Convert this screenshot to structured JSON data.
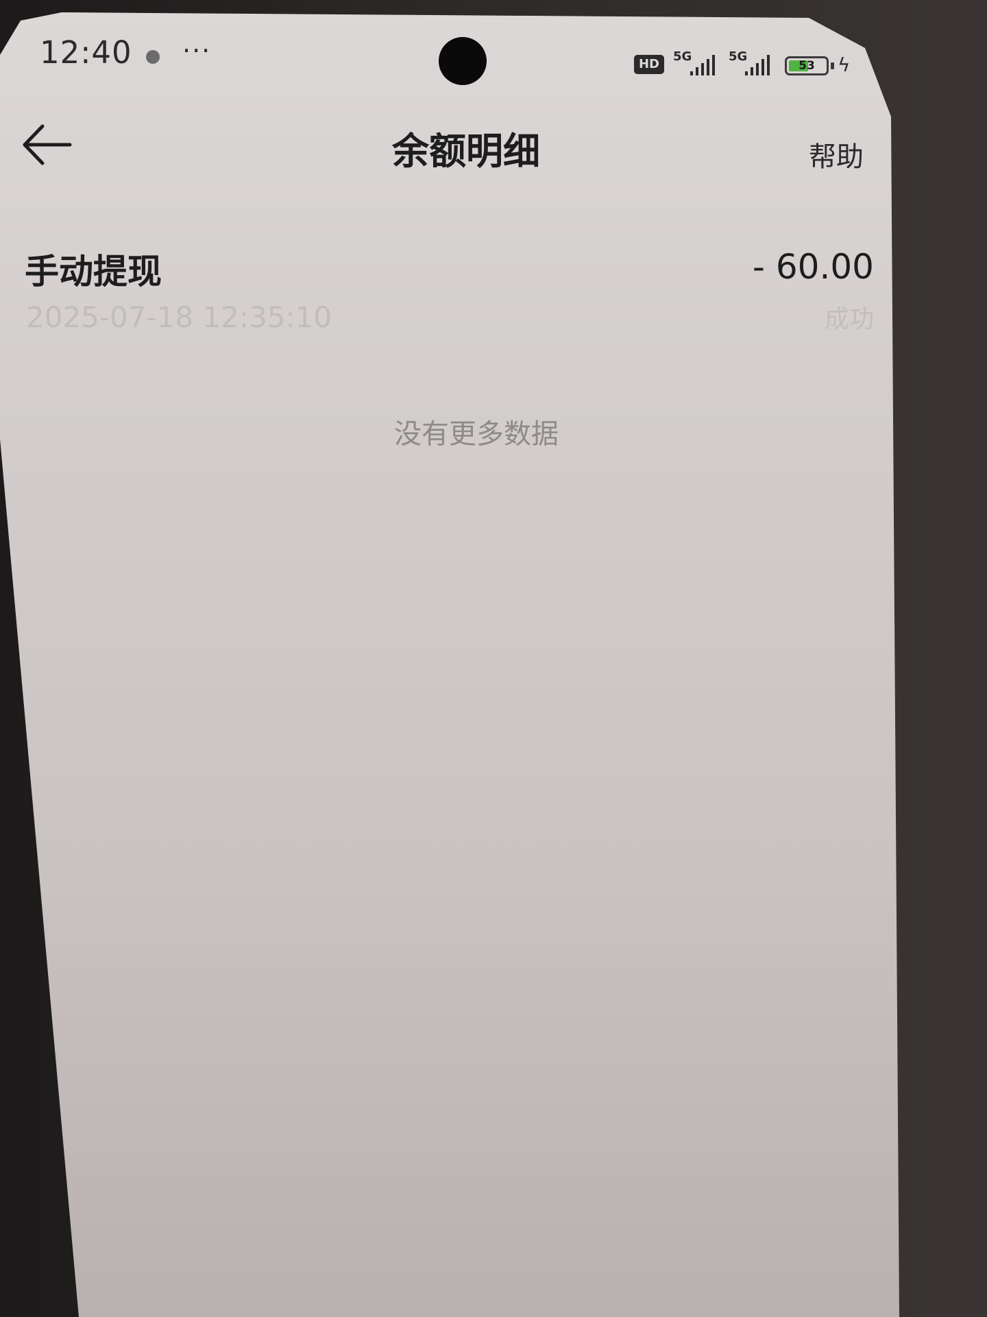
{
  "status_bar": {
    "time": "12:40",
    "more": "···",
    "hd_label": "HD",
    "sim1_label": "5G",
    "sim2_label": "5G",
    "battery_level": "53",
    "battery_fill_percent": 53
  },
  "header": {
    "title": "余额明细",
    "help_label": "帮助"
  },
  "records": [
    {
      "title": "手动提现",
      "amount": "- 60.00",
      "time": "2025-07-18 12:35:10",
      "status": "成功"
    }
  ],
  "footer": {
    "no_more_text": "没有更多数据"
  },
  "colors": {
    "screen_bg": "#d6d1d0",
    "text_primary": "#1e1d1d",
    "text_secondary": "#c1bdbb",
    "battery_green": "#4fb342"
  }
}
